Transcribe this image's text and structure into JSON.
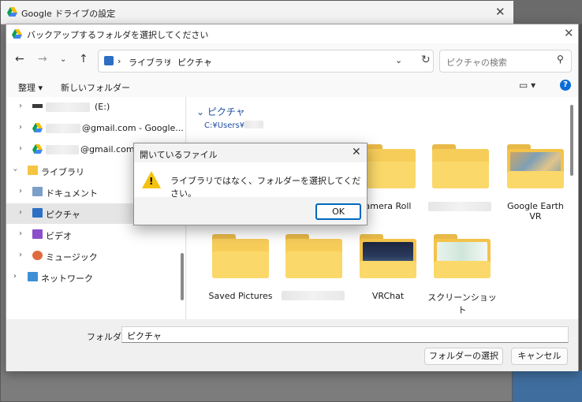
{
  "background_window": {
    "title": "Google ドライブの設定"
  },
  "dialog": {
    "title": "バックアップするフォルダを選択してください",
    "address": {
      "segments": [
        "ライブラリ",
        "ピクチャ"
      ]
    },
    "search": {
      "placeholder": "ピクチャの検索"
    },
    "toolbar": {
      "organize": "整理 ▾",
      "new_folder": "新しいフォルダー"
    },
    "tree": [
      {
        "label": "(E:)"
      },
      {
        "label": "@gmail.com - Google... (G:"
      },
      {
        "label": "@gmail.com - Google... (G"
      },
      {
        "label": "ライブラリ"
      },
      {
        "label": "ドキュメント"
      },
      {
        "label": "ピクチャ"
      },
      {
        "label": "ビデオ"
      },
      {
        "label": "ミュージック"
      },
      {
        "label": "ネットワーク"
      }
    ],
    "content": {
      "heading": "ピクチャ",
      "path": "C:¥Users¥",
      "folders": [
        {
          "label": "amera Roll"
        },
        {
          "label": ""
        },
        {
          "label": "Google Earth VR"
        },
        {
          "label": "Saved Pictures"
        },
        {
          "label": ""
        },
        {
          "label": "VRChat"
        },
        {
          "label": "スクリーンショット"
        }
      ]
    },
    "bottom": {
      "folder_label": "フォルダー:",
      "folder_value": "ピクチャ",
      "select_button": "フォルダーの選択",
      "cancel_button": "キャンセル"
    }
  },
  "message_box": {
    "title": "開いているファイル",
    "text": "ライブラリではなく、フォルダーを選択してください。",
    "ok": "OK"
  },
  "colors": {
    "accent": "#0067c0",
    "folder": "#f7cd5a",
    "link": "#1f4ea1"
  }
}
